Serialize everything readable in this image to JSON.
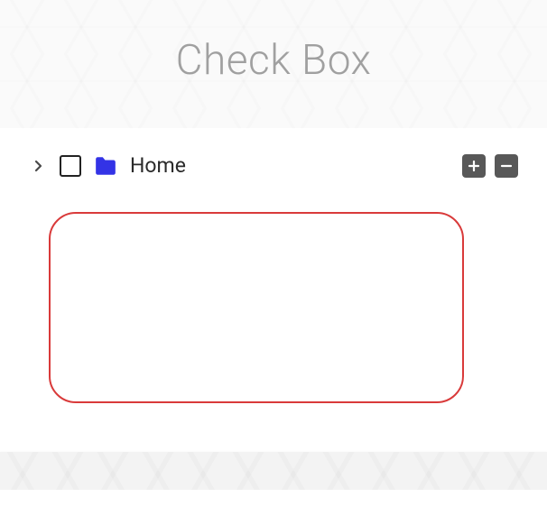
{
  "page": {
    "title": "Check Box"
  },
  "tree": {
    "root": {
      "label": "Home",
      "checked": false,
      "expanded": false,
      "icon": "folder"
    }
  },
  "actions": {
    "expand_all": "+",
    "collapse_all": "-"
  },
  "colors": {
    "folder_icon": "#3333e6",
    "highlight_border": "#d93a3a",
    "action_button_bg": "#585858",
    "title_text": "#a0a0a0"
  }
}
